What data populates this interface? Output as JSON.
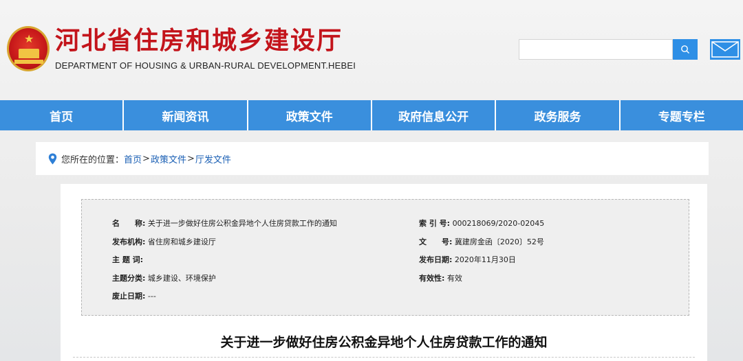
{
  "header": {
    "title_cn": "河北省住房和城乡建设厅",
    "title_en": "DEPARTMENT OF HOUSING & URBAN-RURAL DEVELOPMENT.HEBEI",
    "search_value": "",
    "search_icon": "search-icon",
    "mail_icon": "mail-icon"
  },
  "nav": {
    "items": [
      "首页",
      "新闻资讯",
      "政策文件",
      "政府信息公开",
      "政务服务",
      "专题专栏"
    ]
  },
  "breadcrumb": {
    "prefix": "您所在的位置：",
    "items": [
      "首页",
      "政策文件",
      "厅发文件"
    ],
    "separator": ">"
  },
  "meta": {
    "name_label": "名　　称:",
    "name_value": "关于进一步做好住房公积金异地个人住房贷款工作的通知",
    "publisher_label": "发布机构:",
    "publisher_value": "省住房和城乡建设厅",
    "subject_label": "主 题 词:",
    "subject_value": "",
    "category_label": "主题分类:",
    "category_value": "城乡建设、环境保护",
    "expire_label": "废止日期:",
    "expire_value": "---",
    "index_label": "索 引 号:",
    "index_value": "000218069/2020-02045",
    "docno_label": "文　　号:",
    "docno_value": "冀建房金函〔2020〕52号",
    "date_label": "发布日期:",
    "date_value": "2020年11月30日",
    "validity_label": "有效性:",
    "validity_value": "有效"
  },
  "document": {
    "title": "关于进一步做好住房公积金异地个人住房贷款工作的通知"
  },
  "colors": {
    "brand_red": "#c3141b",
    "nav_blue": "#3a8fdd",
    "link_blue": "#1a5fb4"
  }
}
